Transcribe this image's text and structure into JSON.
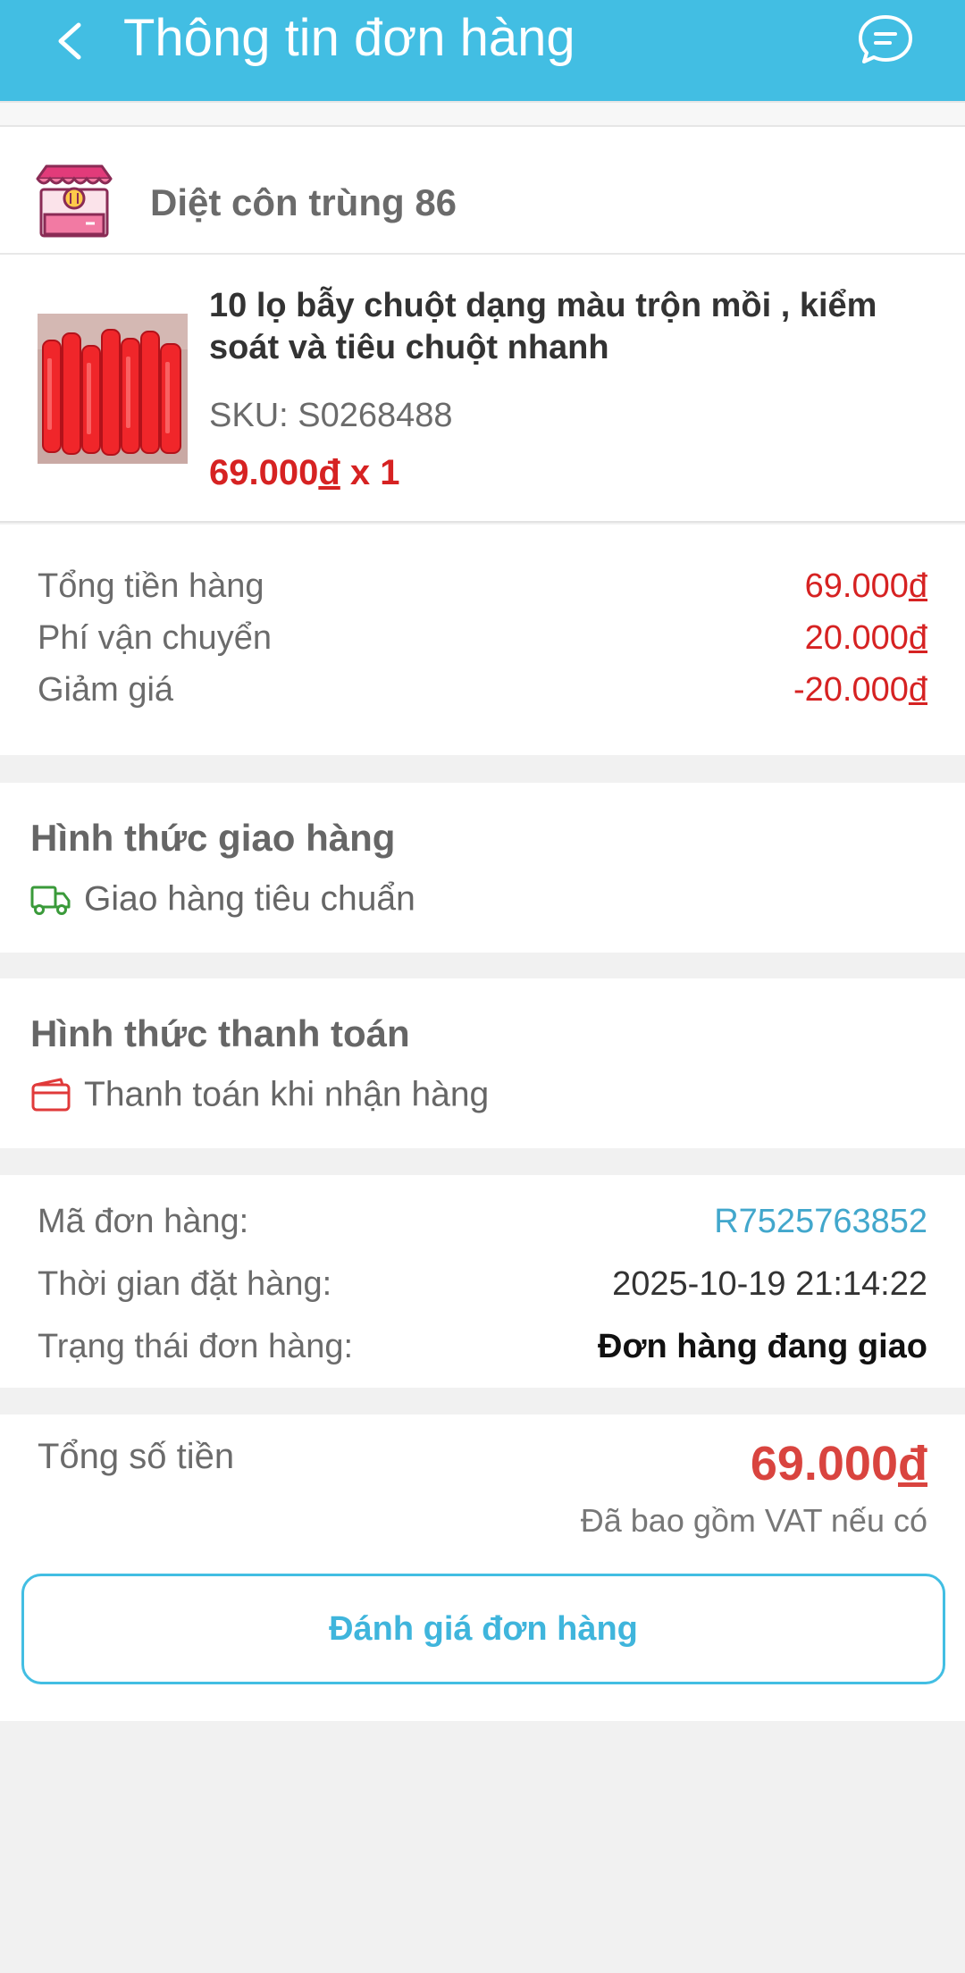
{
  "header": {
    "title": "Thông tin đơn hàng"
  },
  "shop": {
    "name": "Diệt côn trùng 86",
    "icon": "shop-stall-icon"
  },
  "product": {
    "name": "10 lọ bẫy chuột dạng màu trộn mồi , kiểm soát và tiêu chuột nhanh",
    "sku": "SKU: S0268488",
    "price": "69.000",
    "currency": "đ",
    "quantity": " x 1"
  },
  "summary": [
    {
      "label": "Tổng tiền hàng",
      "amount": "69.000",
      "currency": "đ"
    },
    {
      "label": "Phí vận chuyển",
      "amount": "20.000",
      "currency": "đ"
    },
    {
      "label": "Giảm giá",
      "amount": "-20.000",
      "currency": "đ"
    }
  ],
  "shipping": {
    "title": "Hình thức giao hàng",
    "method": "Giao hàng tiêu chuẩn",
    "icon": "truck-icon"
  },
  "payment": {
    "title": "Hình thức thanh toán",
    "method": "Thanh toán khi nhận hàng",
    "icon": "wallet-icon"
  },
  "order_info": {
    "code_label": "Mã đơn hàng:",
    "code": "R7525763852",
    "time_label": "Thời gian đặt hàng:",
    "time": "2025-10-19 21:14:22",
    "status_label": "Trạng thái đơn hàng:",
    "status": "Đơn hàng đang giao"
  },
  "total": {
    "label": "Tổng số tiền",
    "amount": "69.000",
    "currency": "đ",
    "note": "Đã bao gồm VAT nếu có"
  },
  "actions": {
    "review_label": "Đánh giá đơn hàng"
  },
  "colors": {
    "header": "#42bee3",
    "price_red": "#d62222",
    "order_code_blue": "#42a7cc",
    "truck_green": "#3a9a3a",
    "wallet_red": "#e03a3a"
  }
}
